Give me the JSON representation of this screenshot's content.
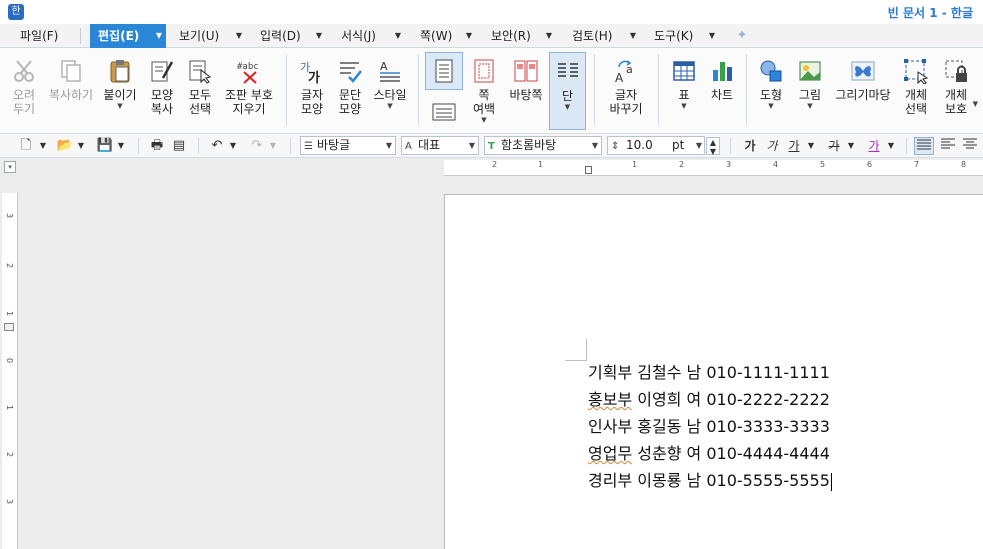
{
  "app": {
    "title": "빈 문서 1 - 한글",
    "icon_glyph": "한"
  },
  "menu": {
    "items": [
      {
        "label": "파일(F)",
        "active": false
      },
      {
        "label": "편집(E)",
        "active": true
      },
      {
        "label": "보기(U)",
        "active": false
      },
      {
        "label": "입력(D)",
        "active": false
      },
      {
        "label": "서식(J)",
        "active": false
      },
      {
        "label": "쪽(W)",
        "active": false
      },
      {
        "label": "보안(R)",
        "active": false
      },
      {
        "label": "검토(H)",
        "active": false
      },
      {
        "label": "도구(K)",
        "active": false
      }
    ],
    "arrow": "▼"
  },
  "ribbon": {
    "cut": "오려\n두기",
    "copy": "복사하기",
    "paste": "붙이기",
    "format_copy": "모양\n복사",
    "select_all": "모두\n선택",
    "remove_codes": "조판 부호\n지우기",
    "char_shape": "글자\n모양",
    "para_shape": "문단\n모양",
    "style": "스타일",
    "margin": "쪽\n여백",
    "background": "바탕쪽",
    "columns": "단",
    "replace": "글자\n바꾸기",
    "table": "표",
    "chart": "차트",
    "shape": "도형",
    "picture": "그림",
    "drawing": "그리기마당",
    "obj_select": "개체\n선택",
    "obj_protect": "개체\n보호"
  },
  "format_toolbar": {
    "style_combo": "바탕글",
    "lang_combo": "대표",
    "font_combo": "함초롬바탕",
    "size_value": "10.0",
    "size_unit": "pt",
    "bold": "가",
    "italic": "가",
    "underline": "가",
    "strike": "가",
    "color": "가"
  },
  "ruler": {
    "h_labels": [
      "2",
      "1",
      "1",
      "2",
      "3",
      "4",
      "5",
      "6",
      "7",
      "8"
    ],
    "v_labels": [
      "3",
      "2",
      "1",
      "0",
      "1",
      "2",
      "3"
    ]
  },
  "document": {
    "lines": [
      {
        "dept": "기획부",
        "name": "김철수",
        "gender": "남",
        "phone": "010-1111-1111",
        "spell_dept": false
      },
      {
        "dept": "홍보부",
        "name": "이영희",
        "gender": "여",
        "phone": "010-2222-2222",
        "spell_dept": true
      },
      {
        "dept": "인사부",
        "name": "홍길동",
        "gender": "남",
        "phone": "010-3333-3333",
        "spell_dept": false
      },
      {
        "dept": "영업무",
        "name": "성춘향",
        "gender": "여",
        "phone": "010-4444-4444",
        "spell_dept": true
      },
      {
        "dept": "경리부",
        "name": "이몽룡",
        "gender": "남",
        "phone": "010-5555-5555",
        "spell_dept": false
      }
    ]
  },
  "colors": {
    "accent": "#2a86d6",
    "title_text": "#2a7ad3",
    "spell_underline": "#d08a3a"
  }
}
